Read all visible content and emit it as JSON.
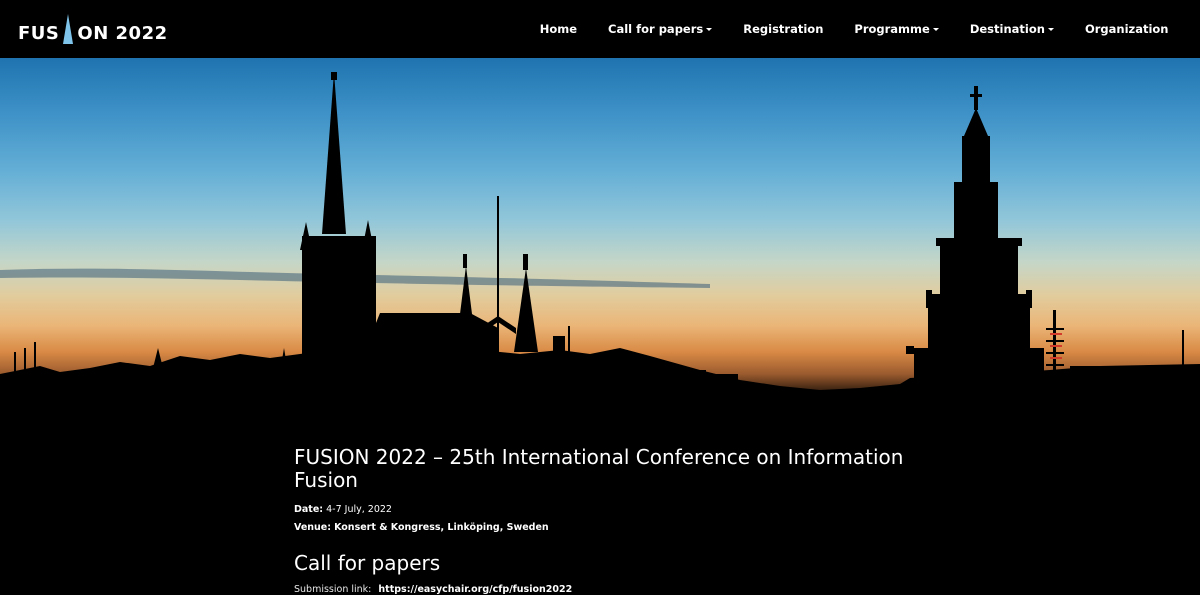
{
  "header": {
    "logo_left": "FUS",
    "logo_right": "ON 2022",
    "nav": [
      {
        "label": "Home",
        "dropdown": false
      },
      {
        "label": "Call for papers",
        "dropdown": true
      },
      {
        "label": "Registration",
        "dropdown": false
      },
      {
        "label": "Programme",
        "dropdown": true
      },
      {
        "label": "Destination",
        "dropdown": true
      },
      {
        "label": "Organization",
        "dropdown": false
      }
    ]
  },
  "main": {
    "title": "FUSION 2022 – 25th International Conference on Information Fusion",
    "date_label": "Date:",
    "date_value": "4-7 July, 2022",
    "venue_label": "Venue:",
    "venue_value": "Konsert & Kongress, Linköping, Sweden",
    "cfp_title": "Call for papers",
    "submission_label": "Submission link:",
    "submission_link": "https://easychair.org/cfp/fusion2022"
  },
  "colors": {
    "sky_top": "#1f74b0",
    "sky_horizon": "#eab577",
    "logo_spire": "#7fc4ea"
  }
}
